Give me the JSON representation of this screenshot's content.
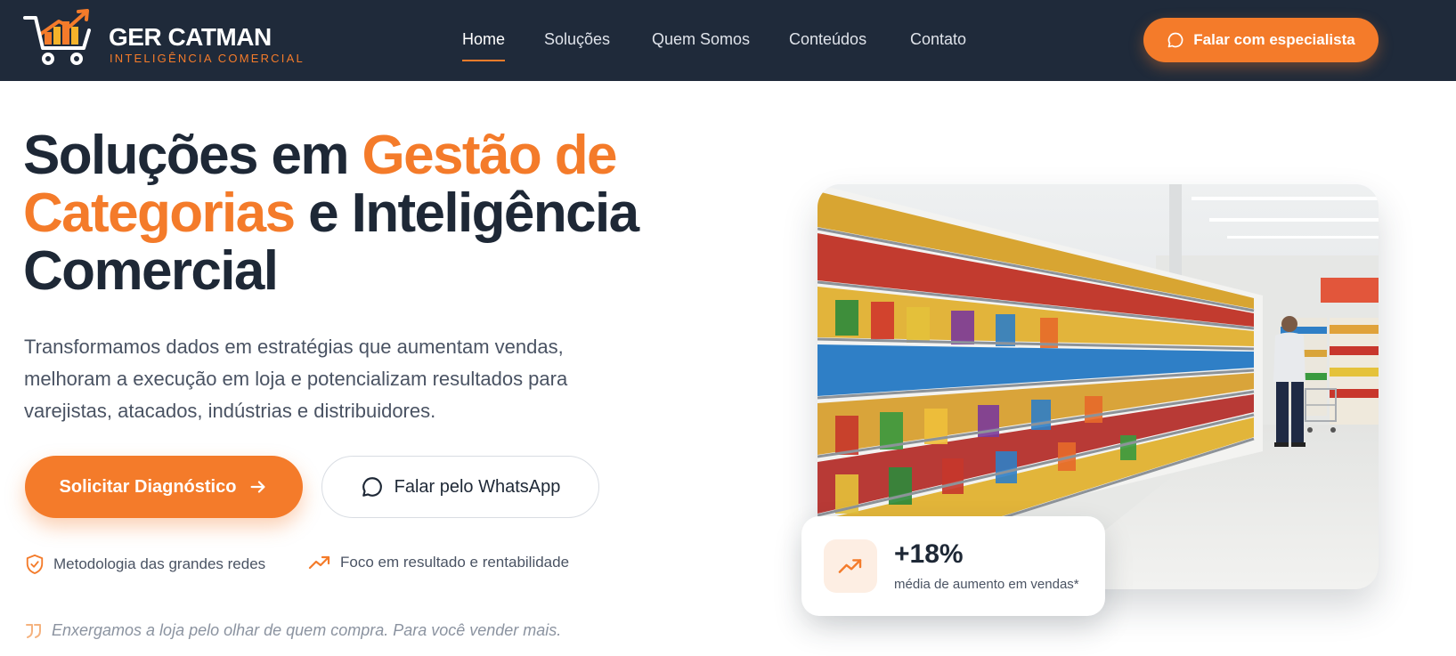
{
  "brand": {
    "name": "GER CATMAN",
    "tagline": "INTELIGÊNCIA COMERCIAL",
    "logo_icon": "shopping-cart-chart-icon"
  },
  "nav": {
    "items": [
      {
        "label": "Home",
        "active": true
      },
      {
        "label": "Soluções",
        "active": false
      },
      {
        "label": "Quem Somos",
        "active": false
      },
      {
        "label": "Conteúdos",
        "active": false
      },
      {
        "label": "Contato",
        "active": false
      }
    ],
    "cta_label": "Falar com especialista",
    "cta_icon": "chat-bubble-icon"
  },
  "hero": {
    "headline": {
      "part1": "Soluções em ",
      "accent1": "Gestão de Categorias",
      "part2": " e Inteligência Comercial"
    },
    "subtext": "Transformamos dados em estratégias que aumentam vendas, melhoram a execução em loja e potencializam resultados para varejistas, atacados, indústrias e distribuidores.",
    "primary_button": "Solicitar Diagnóstico",
    "secondary_button": "Falar pelo WhatsApp",
    "features": [
      {
        "icon": "shield-check-icon",
        "label": "Metodologia das grandes redes"
      },
      {
        "icon": "trending-up-icon",
        "label": "Foco em resultado e rentabilidade"
      }
    ],
    "quote": "Enxergamos a loja pelo olhar de quem compra. Para você vender mais."
  },
  "stat": {
    "value": "+18%",
    "label": "média de aumento em vendas*",
    "icon": "trending-up-icon"
  },
  "colors": {
    "navy": "#1f2a3a",
    "accent": "#f47b2a",
    "text": "#1e2836",
    "muted": "#4a5363"
  }
}
